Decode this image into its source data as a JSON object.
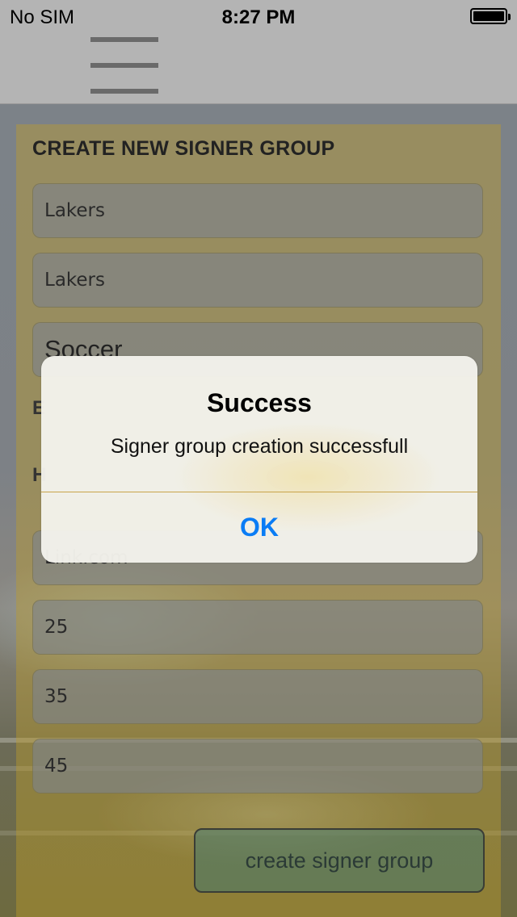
{
  "status": {
    "carrier": "No SIM",
    "time": "8:27 PM"
  },
  "nav": {
    "menu_icon": "hamburger-menu-icon"
  },
  "form": {
    "title": "CREATE NEW SIGNER GROUP",
    "fields": [
      "Lakers",
      "Lakers",
      "Soccer"
    ],
    "partial_field": "Link.com",
    "partial_label_1": "E",
    "partial_label_2": "H",
    "numbers": [
      "25",
      "35",
      "45"
    ],
    "create_button": "create signer group"
  },
  "alert": {
    "title": "Success",
    "message": "Signer group creation successfull",
    "ok": "OK"
  },
  "colors": {
    "accent": "#0a7cf5",
    "panel": "#be9e28"
  }
}
